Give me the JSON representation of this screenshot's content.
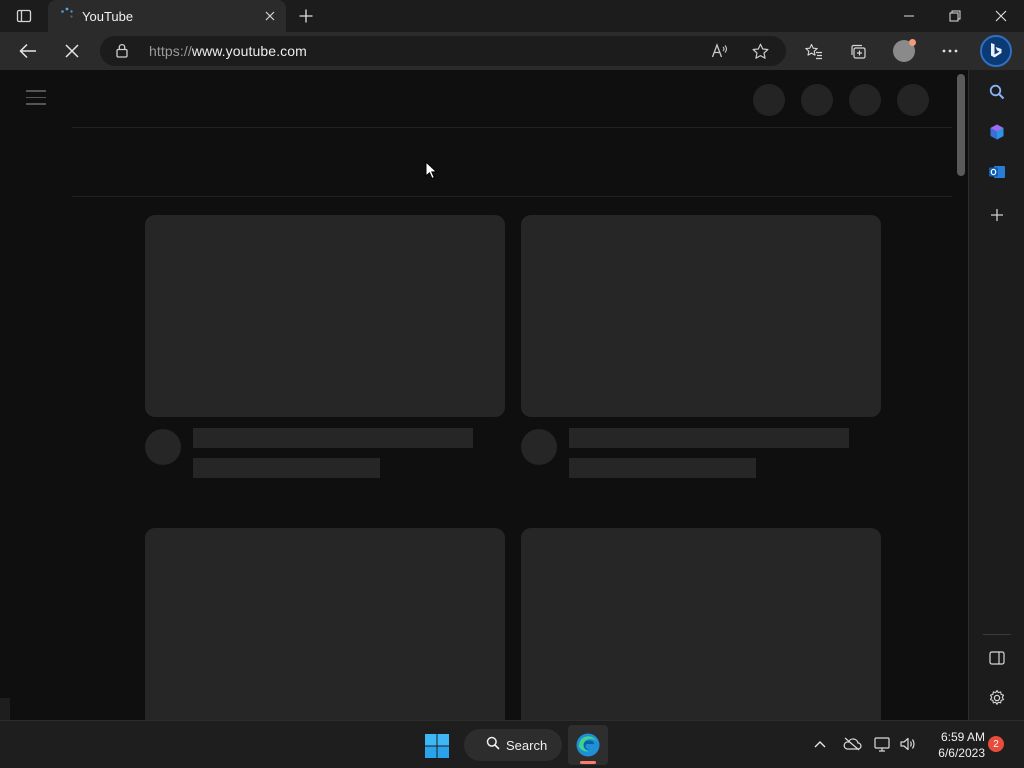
{
  "browser": {
    "tab": {
      "title": "YouTube"
    },
    "address": {
      "scheme": "https://",
      "host": "www.youtube.com"
    }
  },
  "icons": {
    "tab_actions": "tab-actions-icon",
    "favicon": "loading-spinner-icon",
    "tab_close": "close-icon",
    "new_tab": "plus-icon",
    "minimize": "minimize-icon",
    "restore": "restore-icon",
    "close": "close-icon",
    "back": "arrow-left-icon",
    "stop": "stop-icon",
    "lock": "lock-icon",
    "read_aloud": "read-aloud-icon",
    "favorite": "star-icon",
    "favorites": "favorites-icon",
    "collections": "collections-icon",
    "profile": "profile-icon",
    "more": "more-icon",
    "copilot": "bing-icon"
  },
  "sidebar": {
    "items": [
      "search-icon",
      "copilot-icon",
      "outlook-icon",
      "add-icon"
    ],
    "bottom": [
      "hide-sidebar-icon",
      "settings-icon"
    ]
  },
  "taskbar": {
    "search_label": "Search",
    "time": "6:59 AM",
    "date": "6/6/2023",
    "notification_count": "2"
  }
}
